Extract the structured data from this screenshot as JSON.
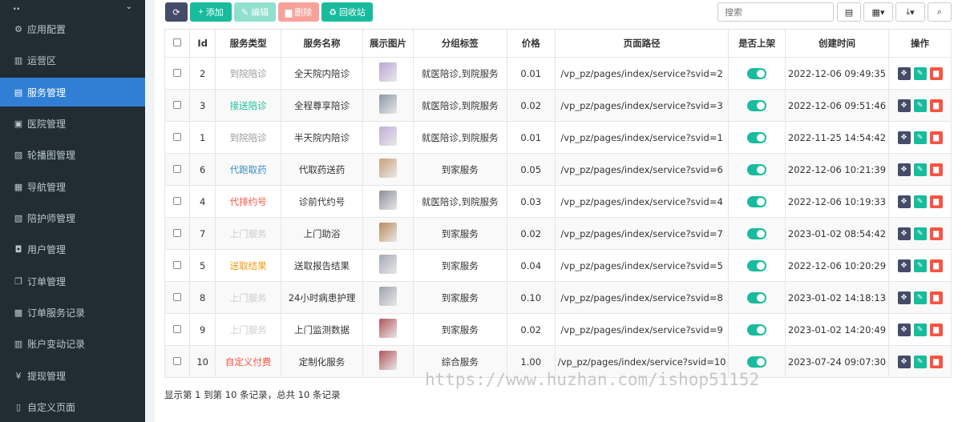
{
  "sidebar": {
    "top_label": "..",
    "items": [
      {
        "label": "应用配置",
        "icon": "gear-icon",
        "glyph": "⚙"
      },
      {
        "label": "运营区",
        "icon": "map-icon",
        "glyph": "▥"
      },
      {
        "label": "服务管理",
        "icon": "list-icon",
        "glyph": "▤"
      },
      {
        "label": "医院管理",
        "icon": "clipboard-icon",
        "glyph": "▣"
      },
      {
        "label": "轮播图管理",
        "icon": "image-icon",
        "glyph": "▨"
      },
      {
        "label": "导航管理",
        "icon": "table-icon",
        "glyph": "▦"
      },
      {
        "label": "陪护师管理",
        "icon": "id-card-icon",
        "glyph": "▧"
      },
      {
        "label": "用户管理",
        "icon": "lock-icon",
        "glyph": "◘"
      },
      {
        "label": "订单管理",
        "icon": "copy-icon",
        "glyph": "❐"
      },
      {
        "label": "订单服务记录",
        "icon": "save-icon",
        "glyph": "▩"
      },
      {
        "label": "账户变动记录",
        "icon": "book-icon",
        "glyph": "▥"
      },
      {
        "label": "提现管理",
        "icon": "yen-icon",
        "glyph": "¥"
      },
      {
        "label": "自定义页面",
        "icon": "file-icon",
        "glyph": "▯"
      }
    ]
  },
  "toolbar": {
    "add": "添加",
    "edit": "编辑",
    "delete": "删除",
    "recycle": "回收站",
    "search_placeholder": "搜索"
  },
  "table": {
    "headers": [
      "",
      "Id",
      "服务类型",
      "服务名称",
      "展示图片",
      "分组标签",
      "价格",
      "页面路径",
      "是否上架",
      "创建时间",
      "操作"
    ],
    "rows": [
      {
        "id": "2",
        "type": "到院陪诊",
        "type_color": "#999999",
        "name": "全天院内陪诊",
        "tags": "就医陪诊,到院服务",
        "price": "0.01",
        "path": "/vp_pz/pages/index/service?svid=2",
        "time": "2022-12-06 09:49:35",
        "img": "#b9a7d6"
      },
      {
        "id": "3",
        "type": "接送陪诊",
        "type_color": "#18bc9c",
        "name": "全程尊享陪诊",
        "tags": "就医陪诊,到院服务",
        "price": "0.02",
        "path": "/vp_pz/pages/index/service?svid=3",
        "time": "2022-12-06 09:51:46",
        "img": "#8a98a8"
      },
      {
        "id": "1",
        "type": "到院陪诊",
        "type_color": "#999999",
        "name": "半天院内陪诊",
        "tags": "就医陪诊,到院服务",
        "price": "0.01",
        "path": "/vp_pz/pages/index/service?svid=1",
        "time": "2022-11-25 14:54:42",
        "img": "#c1aedb"
      },
      {
        "id": "6",
        "type": "代跑取药",
        "type_color": "#3c8dbc",
        "name": "代取药送药",
        "tags": "到家服务",
        "price": "0.05",
        "path": "/vp_pz/pages/index/service?svid=6",
        "time": "2022-12-06 10:21:39",
        "img": "#c8a27a"
      },
      {
        "id": "4",
        "type": "代排约号",
        "type_color": "#f75444",
        "name": "诊前代约号",
        "tags": "就医陪诊,到院服务",
        "price": "0.03",
        "path": "/vp_pz/pages/index/service?svid=4",
        "time": "2022-12-06 10:19:33",
        "img": "#8c8f99"
      },
      {
        "id": "7",
        "type": "上门服务",
        "type_color": "#cccccc",
        "name": "上门助浴",
        "tags": "到家服务",
        "price": "0.02",
        "path": "/vp_pz/pages/index/service?svid=7",
        "time": "2023-01-02 08:54:42",
        "img": "#b98a5b"
      },
      {
        "id": "5",
        "type": "送取结果",
        "type_color": "#f39c12",
        "name": "送取报告结果",
        "tags": "到家服务",
        "price": "0.04",
        "path": "/vp_pz/pages/index/service?svid=5",
        "time": "2022-12-06 10:20:29",
        "img": "#a4a9b5"
      },
      {
        "id": "8",
        "type": "上门服务",
        "type_color": "#cccccc",
        "name": "24小时病患护理",
        "tags": "到家服务",
        "price": "0.10",
        "path": "/vp_pz/pages/index/service?svid=8",
        "time": "2023-01-02 14:18:13",
        "img": "#9fa4ad"
      },
      {
        "id": "9",
        "type": "上门服务",
        "type_color": "#cccccc",
        "name": "上门监测数据",
        "tags": "到家服务",
        "price": "0.02",
        "path": "/vp_pz/pages/index/service?svid=9",
        "time": "2023-01-02 14:20:49",
        "img": "#b3545a"
      },
      {
        "id": "10",
        "type": "自定义付费",
        "type_color": "#f75444",
        "name": "定制化服务",
        "tags": "综合服务",
        "price": "1.00",
        "path": "/vp_pz/pages/index/service?svid=10",
        "time": "2023-07-24 09:07:30",
        "img": "#b3545a"
      }
    ]
  },
  "footer": {
    "info": "显示第 1 到第 10 条记录，总共 10 条记录"
  },
  "watermark": "https://www.huzhan.com/ishop51152",
  "colors": {
    "sidebar_bg": "#222d32",
    "active": "#2f7fd5",
    "green": "#18bc9c",
    "navy": "#444c69",
    "red": "#f75444"
  }
}
